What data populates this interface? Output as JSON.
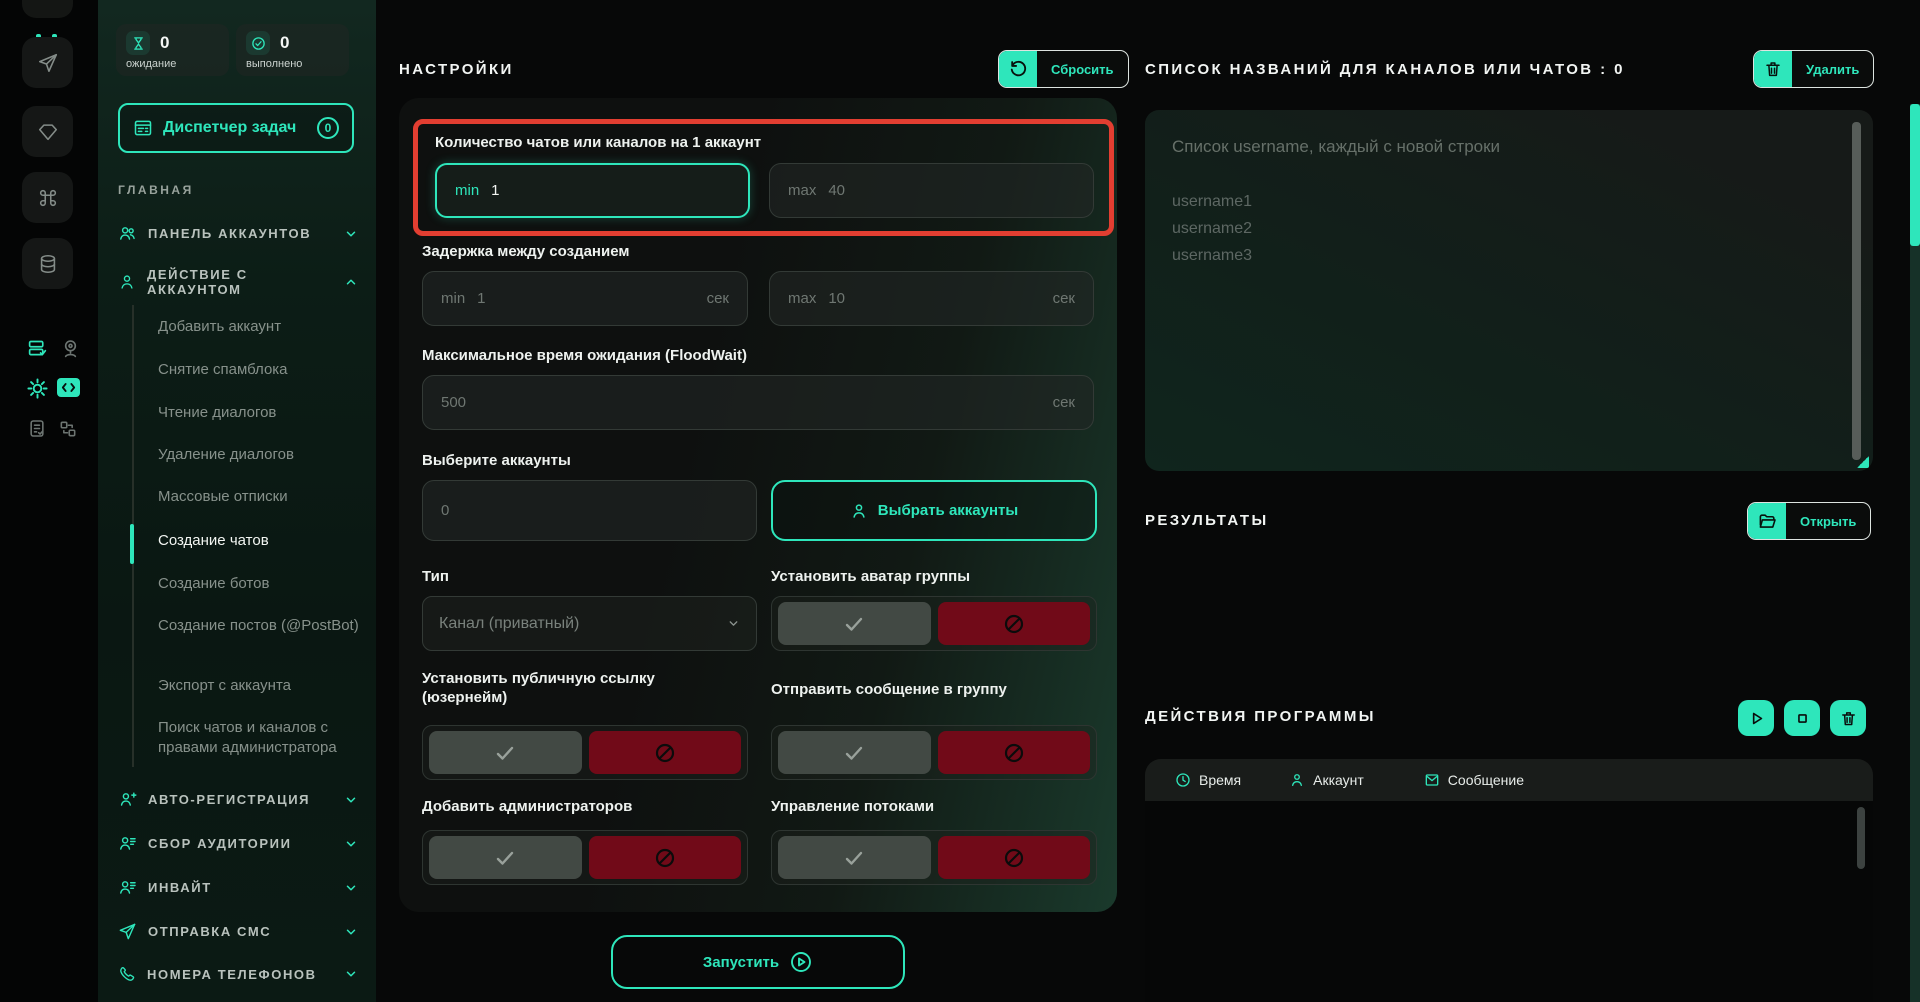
{
  "colors": {
    "accent": "#2ee6bb",
    "danger_border": "#e23e31",
    "deny_red": "#710a18",
    "sidebar_top": "#122820",
    "background": "#070808"
  },
  "iconbar": {
    "icons": [
      "app-logo",
      "paper-plane",
      "diamond",
      "command",
      "database",
      "server-check",
      "webcam",
      "gear",
      "code-window",
      "document-check",
      "swap"
    ]
  },
  "sidebar": {
    "stats": [
      {
        "icon": "hourglass-icon",
        "value": "0",
        "label": "ожидание"
      },
      {
        "icon": "check-circle-icon",
        "value": "0",
        "label": "выполнено"
      }
    ],
    "task_manager": {
      "label": "Диспетчер задач",
      "badge": "0"
    },
    "section_label": "ГЛАВНАЯ",
    "items": [
      {
        "label": "ПАНЕЛЬ АККАУНТОВ",
        "icon": "users-icon",
        "chevron": "down"
      },
      {
        "label": "ДЕЙСТВИЕ С АККАУНТОМ",
        "icon": "user-icon",
        "chevron": "up"
      }
    ],
    "subitems": [
      "Добавить аккаунт",
      "Снятие спамблока",
      "Чтение диалогов",
      "Удаление диалогов",
      "Массовые отписки",
      "Создание чатов",
      "Создание ботов",
      "Создание постов (@PostBot)",
      "Экспорт с аккаунта",
      "Поиск чатов и каналов с правами администратора"
    ],
    "active_subitem": "Создание чатов",
    "bottom_items": [
      {
        "label": "АВТО-РЕГИСТРАЦИЯ",
        "icon": "user-plus-icon"
      },
      {
        "label": "СБОР АУДИТОРИИ",
        "icon": "user-list-icon"
      },
      {
        "label": "ИНВАЙТ",
        "icon": "user-list-icon"
      },
      {
        "label": "ОТПРАВКА СМС",
        "icon": "paper-plane-icon"
      },
      {
        "label": "НОМЕРА ТЕЛЕФОНОВ",
        "icon": "phone-icon"
      }
    ]
  },
  "settings": {
    "title": "НАСТРОЙКИ",
    "reset_button": "Сбросить",
    "qty": {
      "label": "Количество чатов или каналов на 1 аккаунт",
      "min_prefix": "min",
      "min_value": "1",
      "max_prefix": "max",
      "max_placeholder": "40"
    },
    "delay": {
      "label": "Задержка между созданием",
      "min_prefix": "min",
      "min_placeholder": "1",
      "max_prefix": "max",
      "max_placeholder": "10",
      "unit": "сек"
    },
    "floodwait": {
      "label": "Максимальное время ожидания (FloodWait)",
      "placeholder": "500",
      "unit": "сек"
    },
    "accounts": {
      "label": "Выберите аккаунты",
      "value": "0",
      "button": "Выбрать аккаунты"
    },
    "type": {
      "label": "Тип",
      "value": "Канал (приватный)"
    },
    "toggle_labels": [
      "Установить аватар группы",
      "Установить публичную ссылку (юзернейм)",
      "Отправить сообщение в группу",
      "Добавить администраторов",
      "Управление потоками"
    ],
    "run_button": "Запустить"
  },
  "right": {
    "list_title": "СПИСОК НАЗВАНИЙ ДЛЯ КАНАЛОВ ИЛИ ЧАТОВ : 0",
    "delete_button": "Удалить",
    "textarea_placeholder": "Список username, каждый с новой строки",
    "textarea_lines": [
      "username1",
      "username2",
      "username3"
    ],
    "results_title": "РЕЗУЛЬТАТЫ",
    "open_button": "Открыть",
    "actions_title": "ДЕЙСТВИЯ ПРОГРАММЫ",
    "table_headers": [
      {
        "icon": "clock-icon",
        "label": "Время"
      },
      {
        "icon": "user-icon",
        "label": "Аккаунт"
      },
      {
        "icon": "mail-icon",
        "label": "Сообщение"
      }
    ]
  }
}
